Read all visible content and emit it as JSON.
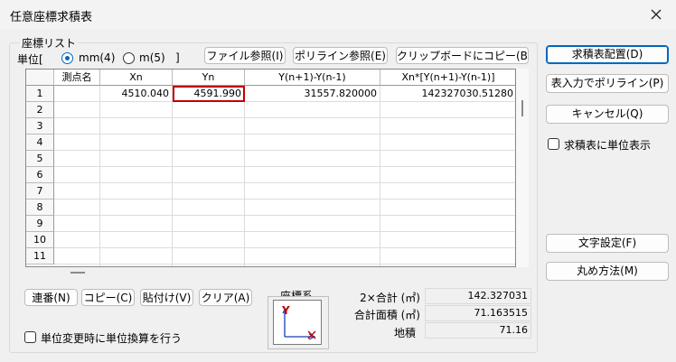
{
  "window": {
    "title": "任意座標求積表"
  },
  "coord_group": {
    "label": "座標リスト",
    "unit_prefix": "単位[",
    "unit_mm": "mm(4)",
    "unit_m": "m(5)",
    "unit_suffix": "]",
    "selected_unit": "mm",
    "file_button": "ファイル参照(I)",
    "polyline_button": "ポリライン参照(E)",
    "clipboard_button": "クリップボードにコピー(B)"
  },
  "table": {
    "columns": [
      "測点名",
      "Xn",
      "Yn",
      "Y(n+1)-Y(n-1)",
      "Xn*[Y(n+1)-Y(n-1)]"
    ],
    "row_numbers": [
      "1",
      "2",
      "3",
      "4",
      "5",
      "6",
      "7",
      "8",
      "9",
      "10",
      "11"
    ],
    "rows": [
      {
        "name": "",
        "xn": "4510.040",
        "yn": "4591.990",
        "dy": "31557.820000",
        "prod": "142327030.51280"
      }
    ]
  },
  "bottom": {
    "serial_button": "連番(N)",
    "copy_button": "コピー(C)",
    "paste_button": "貼付け(V)",
    "clear_button": "クリア(A)",
    "coord_label": "座標系",
    "axis_y": "Y",
    "unit_convert_label": "単位変更時に単位換算を行う"
  },
  "summary": {
    "double_total_label": "2×合計 (㎡)",
    "double_total_value": "142.327031",
    "total_area_label": "合計面積 (㎡)",
    "total_area_value": "71.163515",
    "land_area_label": "地積",
    "land_area_value": "71.16"
  },
  "right_panel": {
    "place_table_button": "求積表配置(D)",
    "polyline_from_input_button": "表入力でポリライン(P)",
    "cancel_button": "キャンセル(Q)",
    "show_unit_label": "求積表に単位表示",
    "text_settings_button": "文字設定(F)",
    "rounding_button": "丸め方法(M)"
  },
  "colors": {
    "accent": "#0067c0",
    "selection": "#c00000",
    "axis_y": "#c00000",
    "axis_x": "#1a3fb0"
  }
}
